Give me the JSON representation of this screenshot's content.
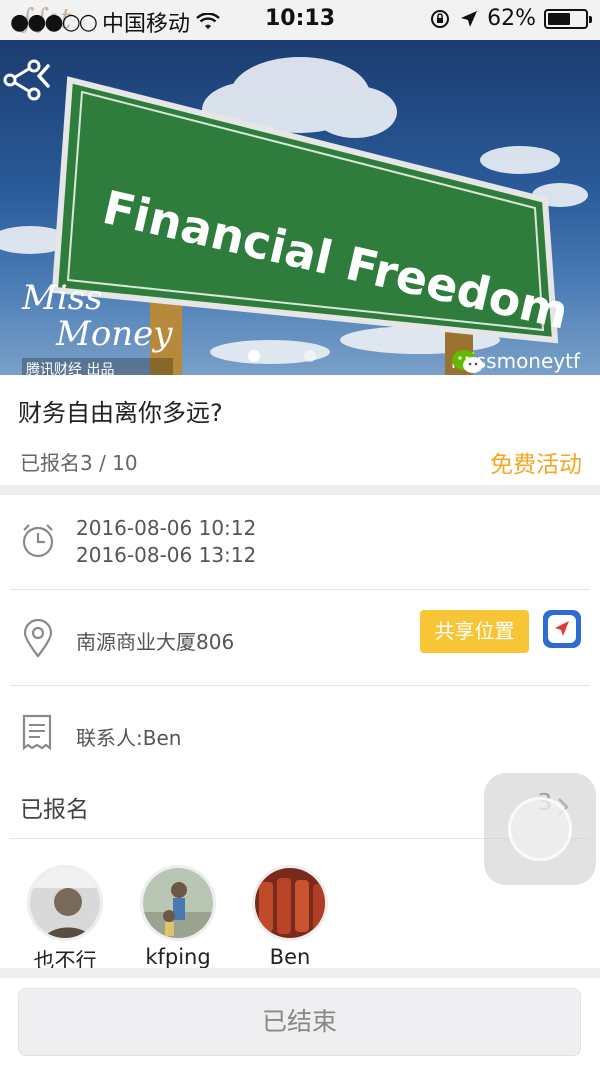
{
  "status_bar": {
    "carrier": "中国移动",
    "time": "10:13",
    "battery": "62%",
    "battery_level": 0.62
  },
  "hero": {
    "sign_text": "Financial Freedom",
    "brand_line1": "Miss",
    "brand_line2": "Money",
    "brand_sub": "腾讯财经 出品",
    "wechat_account": "missmoneytf",
    "slides_count": 2,
    "active_slide": 1
  },
  "event": {
    "title": "财务自由离你多远?",
    "signup_count": "已报名3 / 10",
    "price_tag": "免费活动"
  },
  "details": {
    "start_time": "2016-08-06 10:12",
    "end_time": "2016-08-06 13:12",
    "location": "南源商业大厦806",
    "share_location_label": "共享位置",
    "contact": "联系人:Ben"
  },
  "enrolled": {
    "label": "已报名",
    "count": "3",
    "participants": [
      {
        "name": "也不行"
      },
      {
        "name": "kfping"
      },
      {
        "name": "Ben"
      }
    ]
  },
  "footer": {
    "status_button": "已结束"
  },
  "colors": {
    "accent_orange": "#f5a623",
    "share_btn_yellow": "#f7c536",
    "nav_blue": "#2f6bd1",
    "sign_green": "#2f7d3c"
  }
}
